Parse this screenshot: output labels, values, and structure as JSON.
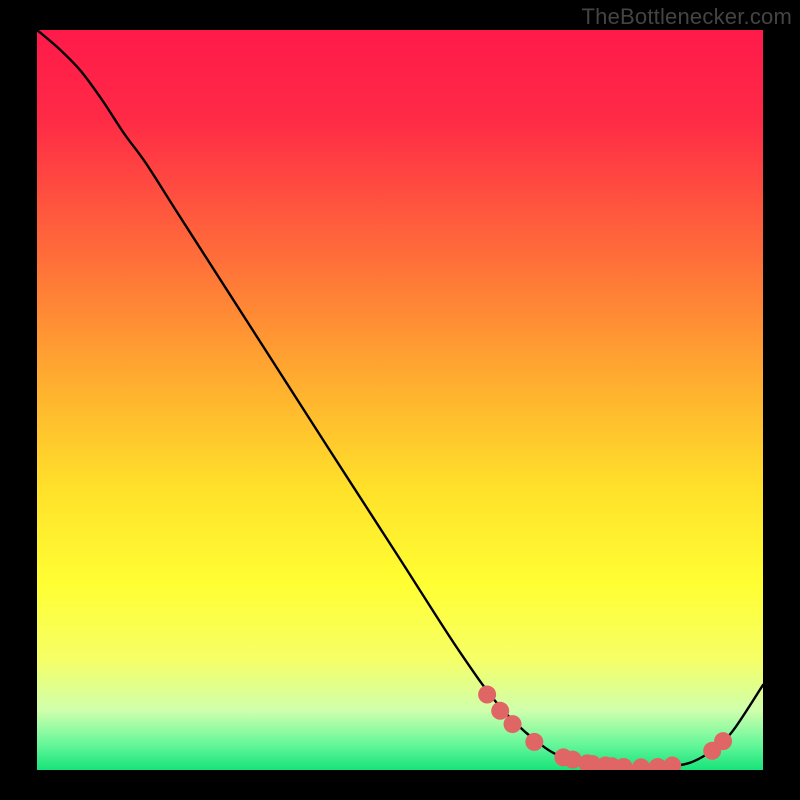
{
  "watermark": "TheBottlenecker.com",
  "chart_data": {
    "type": "line",
    "title": "",
    "xlabel": "",
    "ylabel": "",
    "xlim": [
      0,
      100
    ],
    "ylim": [
      0,
      100
    ],
    "gradient_stops": [
      {
        "offset": 0,
        "color": "#ff1a4a"
      },
      {
        "offset": 0.12,
        "color": "#ff2a46"
      },
      {
        "offset": 0.3,
        "color": "#ff6b3a"
      },
      {
        "offset": 0.48,
        "color": "#ffaf2f"
      },
      {
        "offset": 0.62,
        "color": "#ffe12a"
      },
      {
        "offset": 0.75,
        "color": "#ffff33"
      },
      {
        "offset": 0.85,
        "color": "#f6ff66"
      },
      {
        "offset": 0.92,
        "color": "#cfffad"
      },
      {
        "offset": 0.965,
        "color": "#66f79a"
      },
      {
        "offset": 1.0,
        "color": "#17e37a"
      }
    ],
    "series": [
      {
        "name": "curve",
        "x": [
          0.0,
          3.0,
          6.0,
          9.0,
          12.0,
          15.0,
          20.0,
          30.0,
          40.0,
          50.0,
          58.0,
          64.0,
          70.0,
          74.0,
          78.0,
          82.0,
          86.0,
          90.0,
          93.5,
          96.0,
          100.0
        ],
        "y": [
          100.0,
          97.5,
          94.5,
          90.5,
          86.0,
          82.0,
          74.3,
          59.0,
          43.7,
          28.5,
          16.3,
          8.3,
          3.0,
          1.3,
          0.5,
          0.3,
          0.4,
          1.0,
          3.0,
          5.5,
          11.5
        ]
      }
    ],
    "highlight_points": {
      "name": "dots",
      "color": "#e06666",
      "radius": 9,
      "points": [
        {
          "x": 62.0,
          "y": 10.2
        },
        {
          "x": 63.8,
          "y": 8.0
        },
        {
          "x": 65.5,
          "y": 6.2
        },
        {
          "x": 68.5,
          "y": 3.8
        },
        {
          "x": 72.5,
          "y": 1.7
        },
        {
          "x": 73.8,
          "y": 1.4
        },
        {
          "x": 75.8,
          "y": 0.9
        },
        {
          "x": 76.5,
          "y": 0.8
        },
        {
          "x": 78.3,
          "y": 0.6
        },
        {
          "x": 79.2,
          "y": 0.5
        },
        {
          "x": 80.8,
          "y": 0.4
        },
        {
          "x": 83.2,
          "y": 0.35
        },
        {
          "x": 85.5,
          "y": 0.4
        },
        {
          "x": 87.5,
          "y": 0.6
        },
        {
          "x": 93.0,
          "y": 2.6
        },
        {
          "x": 94.5,
          "y": 3.9
        }
      ]
    }
  }
}
